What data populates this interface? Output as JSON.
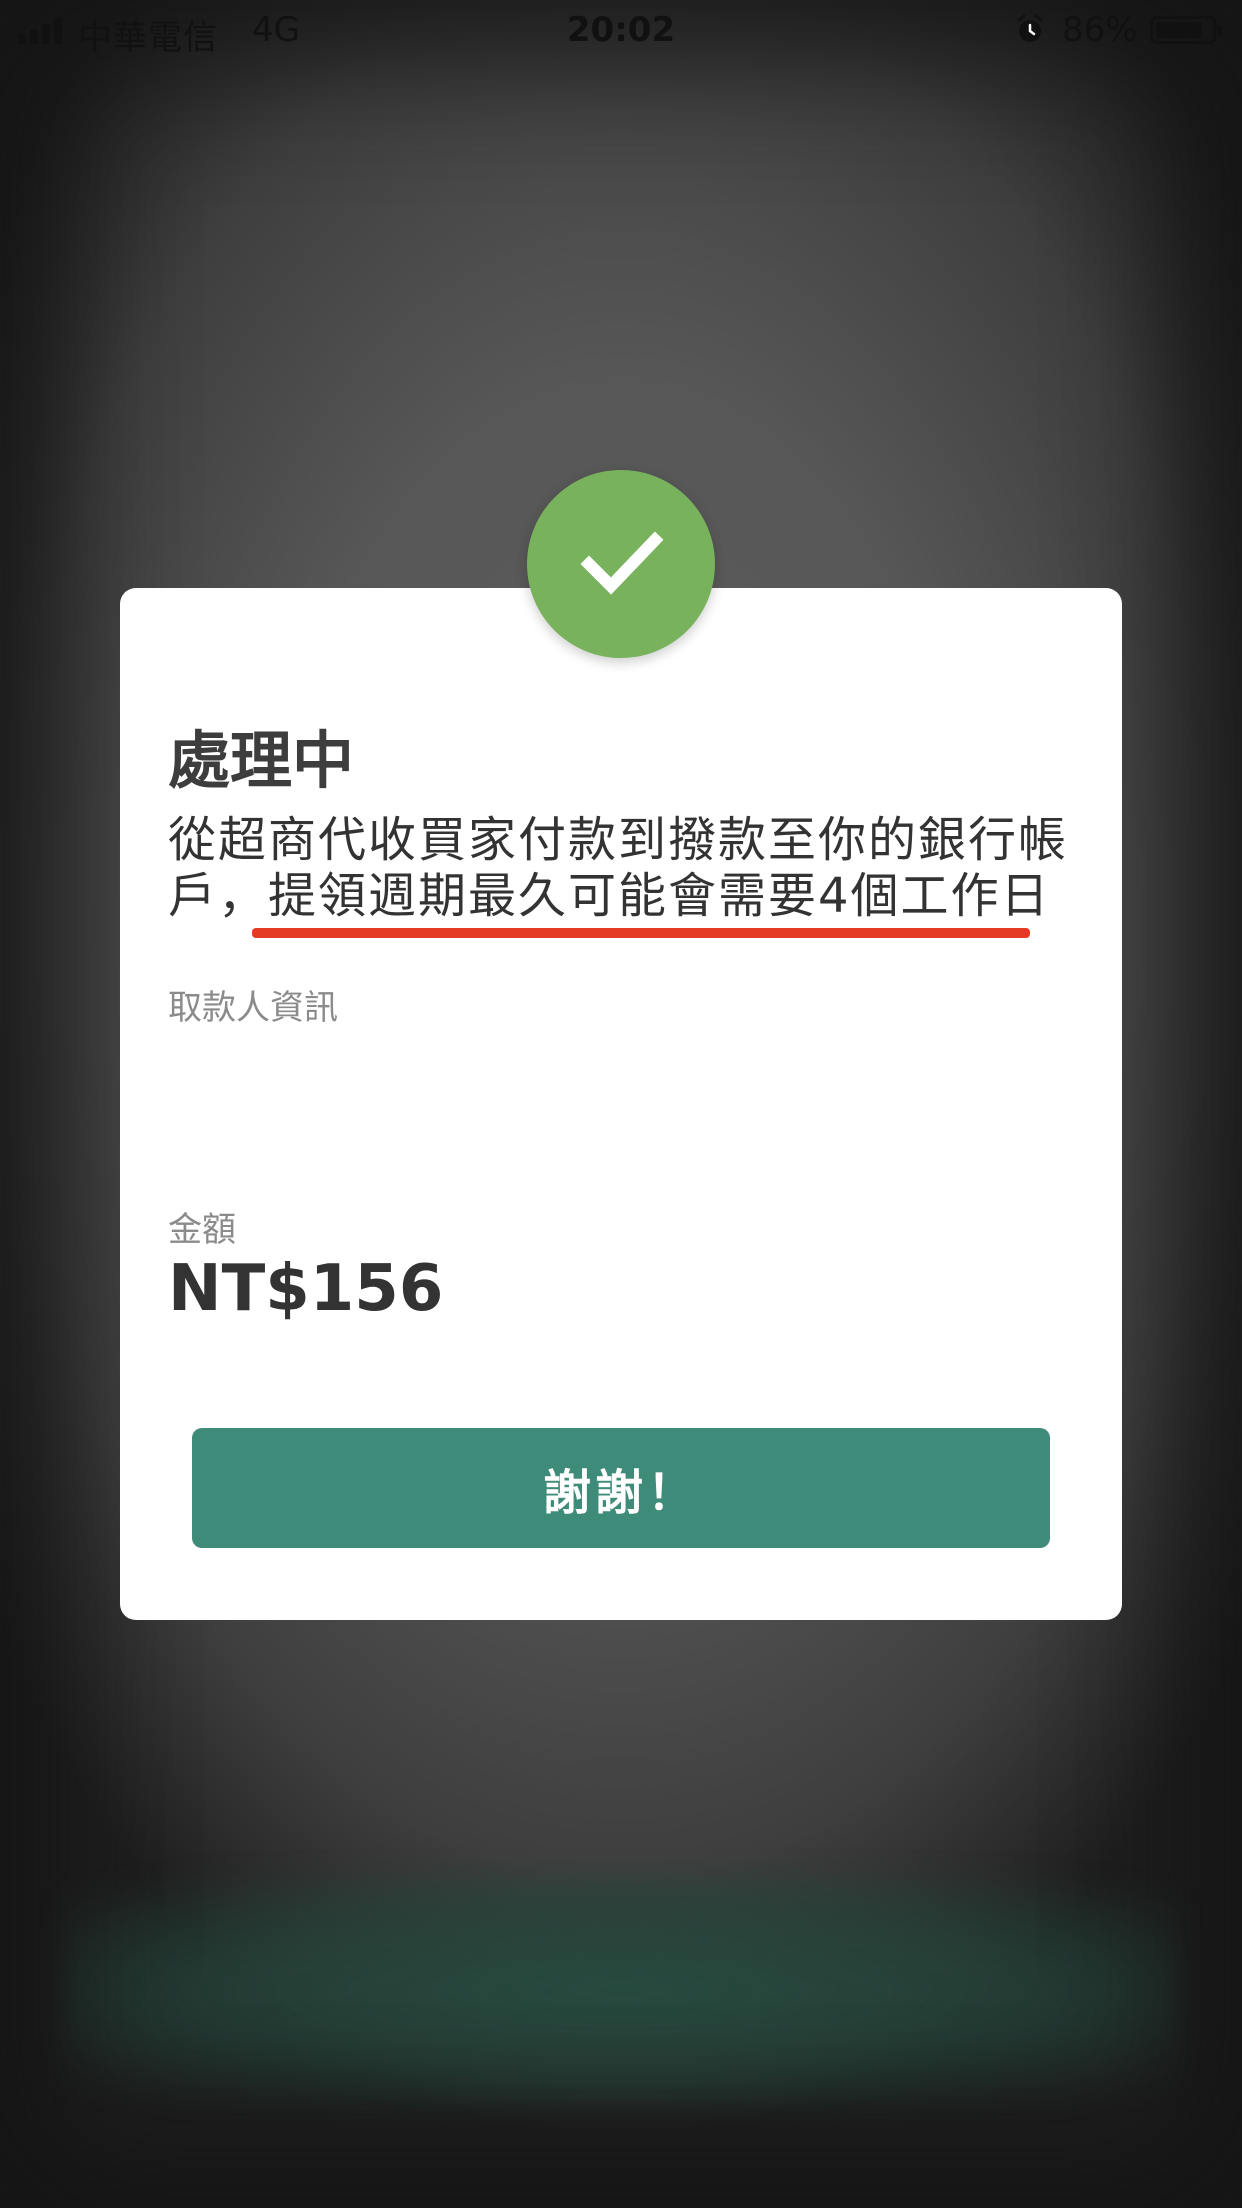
{
  "status_bar": {
    "carrier": "中華電信",
    "network": "4G",
    "time": "20:02",
    "battery": "86%",
    "battery_level": 0.86,
    "signal_icon": "signal-bars-icon",
    "alarm_icon": "alarm-clock-icon",
    "battery_icon": "battery-icon"
  },
  "dialog": {
    "status_icon": "checkmark-icon",
    "status_color": "#79b25c",
    "title": "處理中",
    "message_line1": "從超商代收買家付款到撥款至你的銀行帳",
    "message_line2": "戶，提領週期最久可能會需要4個工作日",
    "highlight_color": "#e53a24",
    "payee_label": "取款人資訊",
    "amount_label": "金額",
    "amount_value": "NT$156",
    "button_label": "謝謝！",
    "button_color": "#3d8b78"
  }
}
